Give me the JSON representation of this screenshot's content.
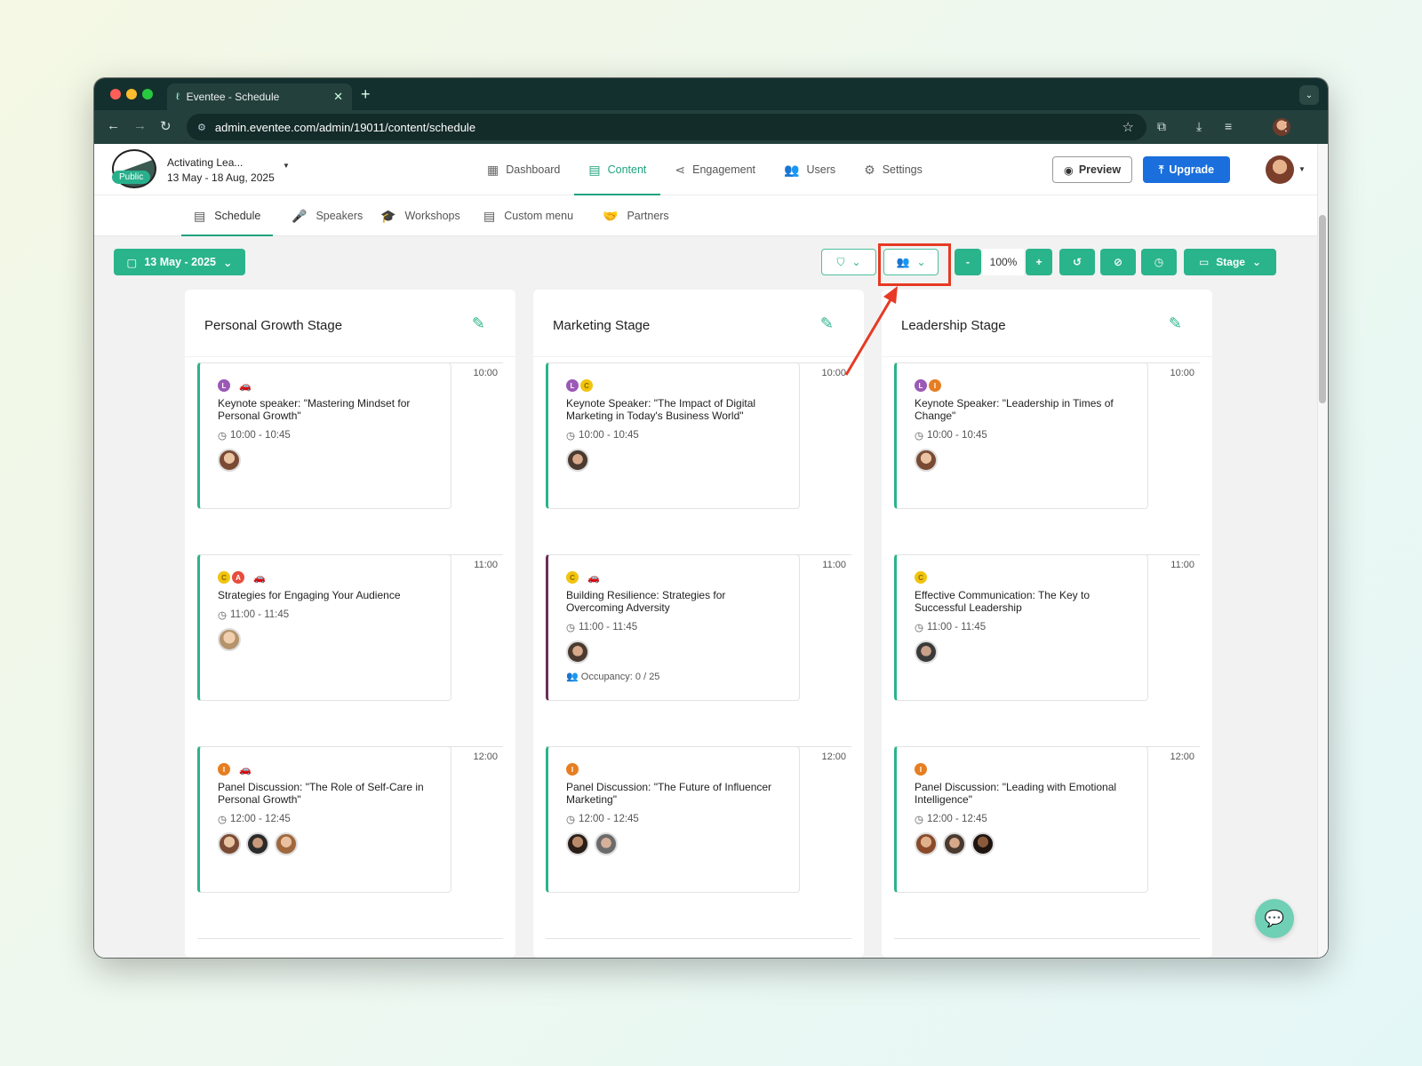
{
  "browser": {
    "tab_title": "Eventee - Schedule",
    "url": "admin.eventee.com/admin/19011/content/schedule"
  },
  "event": {
    "name": "Activating Lea...",
    "dates": "13 May - 18 Aug, 2025",
    "visibility": "Public"
  },
  "topnav": [
    {
      "label": "Dashboard",
      "icon": "grid-icon"
    },
    {
      "label": "Content",
      "icon": "calendar-icon",
      "active": true
    },
    {
      "label": "Engagement",
      "icon": "share-icon"
    },
    {
      "label": "Users",
      "icon": "users-icon"
    },
    {
      "label": "Settings",
      "icon": "gear-icon"
    }
  ],
  "header_actions": {
    "preview_label": "Preview",
    "upgrade_label": "Upgrade"
  },
  "subnav": [
    {
      "label": "Schedule",
      "active": true
    },
    {
      "label": "Speakers"
    },
    {
      "label": "Workshops"
    },
    {
      "label": "Custom menu"
    },
    {
      "label": "Partners"
    }
  ],
  "toolbar": {
    "date_label": "13 May - 2025",
    "zoom_minus": "-",
    "zoom_value": "100%",
    "zoom_plus": "+",
    "view_label": "Stage"
  },
  "colors": {
    "accent": "#2ab48b",
    "highlight": "#e63a24",
    "upgrade": "#1a6fdc",
    "tag_L": "#9b59b6",
    "tag_C": "#f1c40f",
    "tag_A": "#e74c3c",
    "tag_I": "#e67e22"
  },
  "stages": [
    {
      "title": "Personal Growth Stage",
      "sessions": [
        {
          "slot": "10:00",
          "tags": [
            "L",
            "car"
          ],
          "title": "Keynote speaker: \"Mastering Mindset for Personal Growth\"",
          "time": "10:00 - 10:45",
          "speakers": 1
        },
        {
          "slot": "11:00",
          "tags": [
            "C",
            "A",
            "car"
          ],
          "title": "Strategies for Engaging Your Audience",
          "time": "11:00 - 11:45",
          "speakers": 1
        },
        {
          "slot": "12:00",
          "tags": [
            "I",
            "car"
          ],
          "title": "Panel Discussion: \"The Role of Self-Care in Personal Growth\"",
          "time": "12:00 - 12:45",
          "speakers": 3
        }
      ]
    },
    {
      "title": "Marketing Stage",
      "sessions": [
        {
          "slot": "10:00",
          "tags": [
            "L",
            "C"
          ],
          "title": "Keynote Speaker: \"The Impact of Digital Marketing in Today's Business World\"",
          "time": "10:00 - 10:45",
          "speakers": 1
        },
        {
          "slot": "11:00",
          "tags": [
            "C",
            "car"
          ],
          "title": "Building Resilience: Strategies for Overcoming Adversity",
          "time": "11:00 - 11:45",
          "speakers": 1,
          "occupancy": "Occupancy: 0 / 25"
        },
        {
          "slot": "12:00",
          "tags": [
            "I"
          ],
          "title": "Panel Discussion: \"The Future of Influencer Marketing\"",
          "time": "12:00 - 12:45",
          "speakers": 2
        }
      ]
    },
    {
      "title": "Leadership Stage",
      "sessions": [
        {
          "slot": "10:00",
          "tags": [
            "L",
            "I"
          ],
          "title": "Keynote Speaker: \"Leadership in Times of Change\"",
          "time": "10:00 - 10:45",
          "speakers": 1
        },
        {
          "slot": "11:00",
          "tags": [
            "C"
          ],
          "title": "Effective Communication: The Key to Successful Leadership",
          "time": "11:00 - 11:45",
          "speakers": 1
        },
        {
          "slot": "12:00",
          "tags": [
            "I"
          ],
          "title": "Panel Discussion: \"Leading with Emotional Intelligence\"",
          "time": "12:00 - 12:45",
          "speakers": 3
        }
      ]
    }
  ]
}
